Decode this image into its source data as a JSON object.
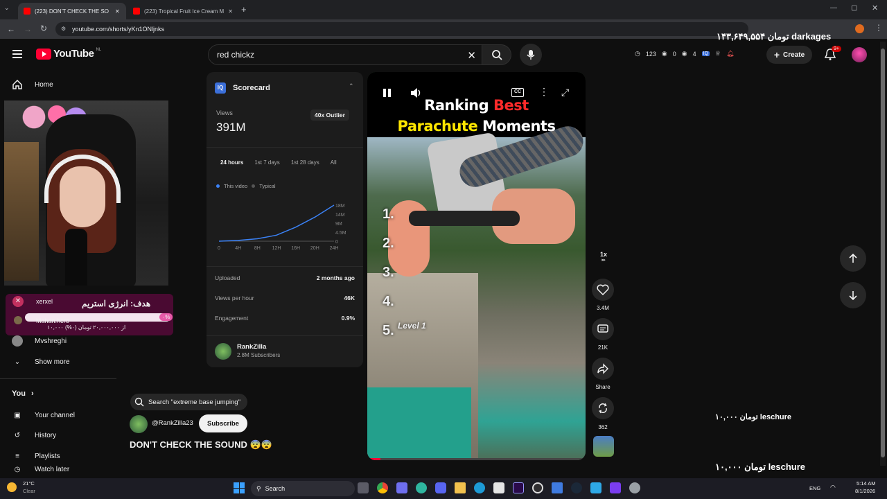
{
  "browser": {
    "tabs": [
      {
        "title": "(223) DON'T CHECK THE SO",
        "active": true
      },
      {
        "title": "(223) Tropical Fruit Ice Cream M",
        "active": false
      }
    ],
    "url": "youtube.com/shorts/yKn1ONljnks"
  },
  "header": {
    "logo_text": "YouTube",
    "region": "NL",
    "search_value": "red chickz",
    "ext_counts": {
      "a": "123",
      "b": "0",
      "c": "4"
    },
    "create_label": "Create",
    "notif_badge": "9+"
  },
  "sidebar": {
    "home": "Home",
    "subs": [
      "Mvshreghi"
    ],
    "show_more": "Show more",
    "you": "You",
    "you_items": [
      "Your channel",
      "History",
      "Playlists",
      "Watch later"
    ]
  },
  "stream_overlay": {
    "goal_title": "هدف: انرژی استریم",
    "goal_user1": "xerxel",
    "goal_user2": "Mahan.hero",
    "goal_amount": "۱۰,۰۰۰ از ۲۰,۰۰۰,۰۰۰ تومان (۰%)",
    "goal_pct": "۰%",
    "donation_top": "۱۴۳,۶۴۹,۵۵۴ تومان darkages",
    "donation_mid": "۱۰,۰۰۰ تومان leschure",
    "donation_bottom": "۱۰,۰۰۰ تومان leschure"
  },
  "scorecard": {
    "title": "Scorecard",
    "views_label": "Views",
    "views_value": "391M",
    "outlier": "40x Outlier",
    "tabs": [
      "24 hours",
      "1st 7 days",
      "1st 28 days",
      "All"
    ],
    "active_tab": "24 hours",
    "legend": [
      "This video",
      "Typical"
    ],
    "y_ticks": [
      "18M",
      "14M",
      "9M",
      "4.5M",
      "0"
    ],
    "x_ticks": [
      "0",
      "4H",
      "8H",
      "12H",
      "16H",
      "20H",
      "24H"
    ],
    "stats": [
      {
        "label": "Uploaded",
        "value": "2 months ago"
      },
      {
        "label": "Views per hour",
        "value": "46K"
      },
      {
        "label": "Engagement",
        "value": "0.9%"
      }
    ],
    "channel_name": "RankZilla",
    "channel_subs": "2.8M Subscribers"
  },
  "chart_data": {
    "type": "line",
    "x": [
      0,
      4,
      8,
      12,
      16,
      20,
      24
    ],
    "series": [
      {
        "name": "This video",
        "values": [
          0,
          0.4,
          1.2,
          3,
          7,
          12,
          18
        ]
      }
    ],
    "x_tick_labels": [
      "0",
      "4H",
      "8H",
      "12H",
      "16H",
      "20H",
      "24H"
    ],
    "y_tick_labels": [
      "18M",
      "14M",
      "9M",
      "4.5M",
      "0"
    ],
    "ylim": [
      0,
      18
    ]
  },
  "short": {
    "search_pill": "Search \"extreme base jumping\"",
    "channel_handle": "@RankZilla23",
    "subscribe_label": "Subscribe",
    "title": "DON'T CHECK THE SOUND 😨😨",
    "overlay_line1a": "Ranking",
    "overlay_line1b": "Best",
    "overlay_line2a": "Parachute",
    "overlay_line2b": "Moments",
    "list": [
      "1.",
      "2.",
      "3.",
      "4.",
      "5."
    ],
    "level_label": "Level 1",
    "speed": "1x",
    "likes": "3.4M",
    "comments": "21K",
    "share": "Share",
    "remix": "362"
  },
  "taskbar": {
    "weather_temp": "21°C",
    "weather_desc": "Clear",
    "search_label": "Search",
    "lang": "ENG",
    "time": "5:14 AM",
    "date": "8/1/2026"
  },
  "colors": {
    "accent_red": "#ff0033",
    "best_red": "#ff2a2a",
    "yellow": "#ffe600",
    "panel": "#1c1c1c"
  }
}
